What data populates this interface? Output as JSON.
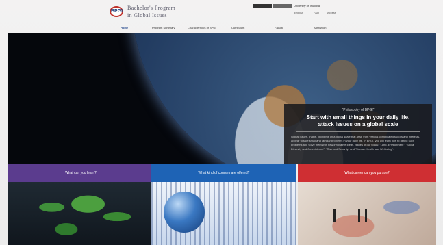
{
  "header": {
    "logo_badge": "BPGI",
    "logo_line1": "Bachelor's Program",
    "logo_line2": "in Global Issues",
    "top_button_1": "",
    "top_button_2": "",
    "top_link": "University of Tsukuba",
    "sub_links": [
      "English",
      "FAQ",
      "Access"
    ]
  },
  "nav": {
    "items": [
      "Home",
      "Program Summary",
      "Characteristics of BPGI",
      "Curriculum",
      "Faculty",
      "Admission"
    ]
  },
  "hero": {
    "subtitle": "\"Philosophy of BPGI\"",
    "headline_1": "Start with small things in your daily life,",
    "headline_2": "attack issues on a global scale",
    "body": "Global issues, that is, problems on a global scale that arise from various complicated factors and interests, appear to take small and familiar problems in your daily life. In BPGI, you will learn how to detect such problems and solve them with new innovative ideas. Issues of our focus: \"Land, Environment\", \"Social Diversity and Co-existence\", \"Risk and Security\" and \"Human Health and Wellbeing\"."
  },
  "tiles": [
    {
      "label": "What can you learn?",
      "color": "#5b3c8e"
    },
    {
      "label": "What kind of courses are offered?",
      "color": "#1e63b5"
    },
    {
      "label": "What career can you pursue?",
      "color": "#cf2f33"
    }
  ]
}
